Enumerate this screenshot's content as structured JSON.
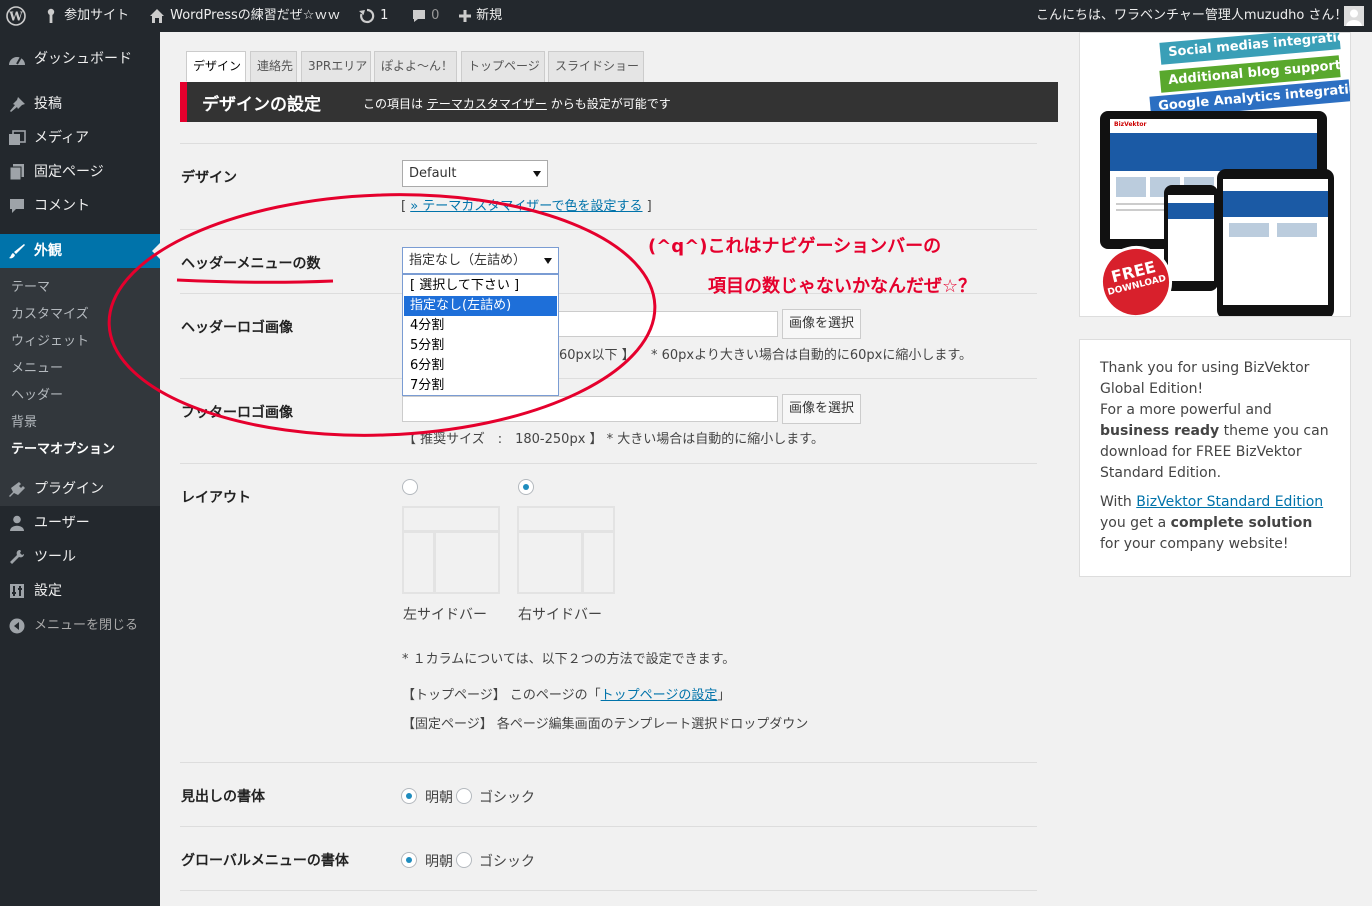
{
  "adminbar": {
    "site_name": "参加サイト",
    "site_title": "WordPressの練習だぜ☆ｗｗ",
    "updates_count": "1",
    "comments_count": "0",
    "new_label": "新規",
    "greeting": "こんにちは、ワラベンチャー管理人muzudho さん！"
  },
  "sidebar": {
    "items": [
      {
        "label": "ダッシュボード",
        "icon": "dashboard-icon"
      },
      {
        "label": "投稿",
        "icon": "pin-icon"
      },
      {
        "label": "メディア",
        "icon": "media-icon"
      },
      {
        "label": "固定ページ",
        "icon": "page-icon"
      },
      {
        "label": "コメント",
        "icon": "comment-icon"
      },
      {
        "label": "外観",
        "icon": "brush-icon"
      },
      {
        "label": "プラグイン",
        "icon": "plugin-icon"
      },
      {
        "label": "ユーザー",
        "icon": "user-icon"
      },
      {
        "label": "ツール",
        "icon": "wrench-icon"
      },
      {
        "label": "設定",
        "icon": "settings-icon"
      },
      {
        "label": "メニューを閉じる",
        "icon": "collapse-icon"
      }
    ],
    "submenu": [
      "テーマ",
      "カスタマイズ",
      "ウィジェット",
      "メニュー",
      "ヘッダー",
      "背景",
      "テーマオプション"
    ]
  },
  "tabs": [
    "デザイン",
    "連絡先",
    "3PRエリア",
    "ぽよよ～ん！",
    "トップページ",
    "スライドショー"
  ],
  "title": {
    "heading": "デザインの設定",
    "sub_prefix": "この項目は",
    "sub_link": "テーマカスタマイザー",
    "sub_suffix": "からも設定が可能です"
  },
  "design": {
    "label": "デザイン",
    "value": "Default",
    "link_open": "[",
    "link": "» テーマカスタマイザーで色を設定する",
    "link_close": "]"
  },
  "header_menu": {
    "label": "ヘッダーメニューの数",
    "value": "指定なし（左詰め）",
    "options": [
      "[ 選択して下さい ]",
      "指定なし(左詰め)",
      "4分割",
      "5分割",
      "6分割",
      "7分割"
    ]
  },
  "header_logo": {
    "label": "ヘッダーロゴ画像",
    "button": "画像を選択",
    "note_a": "60px以下 】",
    "note_b": "* 60pxより大きい場合は自動的に60pxに縮小します。"
  },
  "footer_logo": {
    "label": "フッターロゴ画像",
    "button": "画像を選択",
    "note": "【 推奨サイズ　:　180-250px 】 * 大きい場合は自動的に縮小します。"
  },
  "layout": {
    "label": "レイアウト",
    "left_label": "左サイドバー",
    "right_label": "右サイドバー",
    "selected": "右サイドバー",
    "note1": "* １カラムについては、以下２つの方法で設定できます。",
    "note2_prefix": "【トップページ】 このページの「",
    "note2_link": "トップページの設定",
    "note2_suffix": "」",
    "note3": "【固定ページ】 各ページ編集画面のテンプレート選択ドロップダウン"
  },
  "heading_font": {
    "label": "見出しの書体",
    "opt1": "明朝",
    "opt2": "ゴシック",
    "selected": "明朝"
  },
  "global_font": {
    "label": "グローバルメニューの書体",
    "opt1": "明朝",
    "opt2": "ゴシック",
    "selected": "明朝"
  },
  "annotation": {
    "line1": "(^q^)これはナビゲーションバーの",
    "line2": "項目の数じゃないかなんだぜ☆？"
  },
  "promo": {
    "ribbons": [
      "Social medias integration",
      "Additional blog support",
      "Google Analytics integration"
    ],
    "brand": "BizVektor",
    "badge_1": "FREE",
    "badge_2": "DOWNLOAD"
  },
  "thanks": {
    "p1_a": "Thank you for using BizVektor Global Edition!",
    "p1_b": "For a more powerful and ",
    "p1_b_bold": "business ready",
    "p1_c": " theme you can download for FREE BizVektor Standard Edition.",
    "p2_a": "With ",
    "p2_link": "BizVektor Standard Edition",
    "p2_b": " you get a ",
    "p2_bold": "complete solution",
    "p2_c": " for your company website!"
  },
  "colors": {
    "accent": "#0073aa",
    "annotation": "#e5002d",
    "title_bar": "#333333"
  }
}
